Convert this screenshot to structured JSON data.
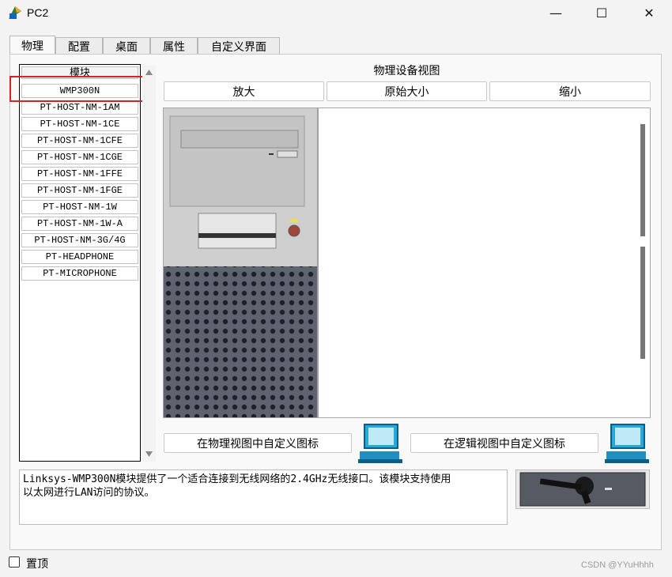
{
  "window": {
    "title": "PC2",
    "controls": {
      "minimize": "—",
      "maximize": "☐",
      "close": "✕"
    }
  },
  "tabs": [
    "物理",
    "配置",
    "桌面",
    "属性",
    "自定义界面"
  ],
  "modules": {
    "header": "模块",
    "items": [
      "WMP300N",
      "PT-HOST-NM-1AM",
      "PT-HOST-NM-1CE",
      "PT-HOST-NM-1CFE",
      "PT-HOST-NM-1CGE",
      "PT-HOST-NM-1FFE",
      "PT-HOST-NM-1FGE",
      "PT-HOST-NM-1W",
      "PT-HOST-NM-1W-A",
      "PT-HOST-NM-3G/4G",
      "PT-HEADPHONE",
      "PT-MICROPHONE"
    ],
    "selected": "WMP300N"
  },
  "physical_view": {
    "title": "物理设备视图",
    "zoom_in": "放大",
    "original_size": "原始大小",
    "zoom_out": "缩小"
  },
  "custom_icons": {
    "physical": "在物理视图中自定义图标",
    "logical": "在逻辑视图中自定义图标"
  },
  "description": {
    "text_line1": "Linksys-WMP300N模块提供了一个适合连接到无线网络的2.4GHz无线接口。该模块支持使用",
    "text_line2": "以太网进行LAN访问的协议。"
  },
  "footer": {
    "pin_label": "置顶",
    "watermark": "CSDN @YYuHhhh"
  },
  "colors": {
    "highlight": "#e02020"
  }
}
